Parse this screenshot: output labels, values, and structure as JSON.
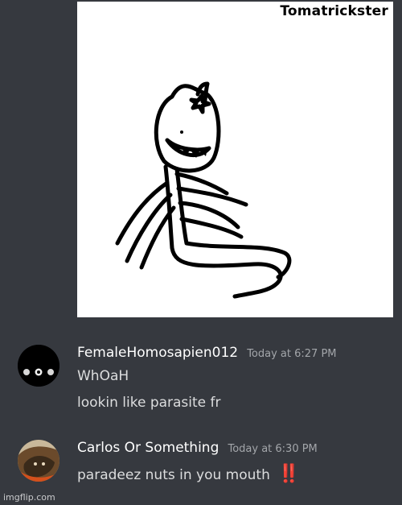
{
  "attachment": {
    "caption": "Tomatrickster",
    "image_icon": "creature-drawing"
  },
  "messages": [
    {
      "username": "FemaleHomosapien012",
      "timestamp": "Today at 6:27 PM",
      "lines": [
        "WhOaH",
        "lookin like parasite fr"
      ],
      "avatar_icon": "black-circle-avatar"
    },
    {
      "username": "Carlos Or Something",
      "timestamp": "Today at 6:30 PM",
      "lines": [
        "paradeez nuts in you mouth"
      ],
      "emoji": "‼️",
      "avatar_icon": "photo-avatar"
    }
  ],
  "watermark": "imgflip.com",
  "colors": {
    "background": "#36393f",
    "username": "#ffffff",
    "timestamp": "#a3a6aa",
    "text": "#dcddde",
    "emoji": "#e0262e"
  }
}
